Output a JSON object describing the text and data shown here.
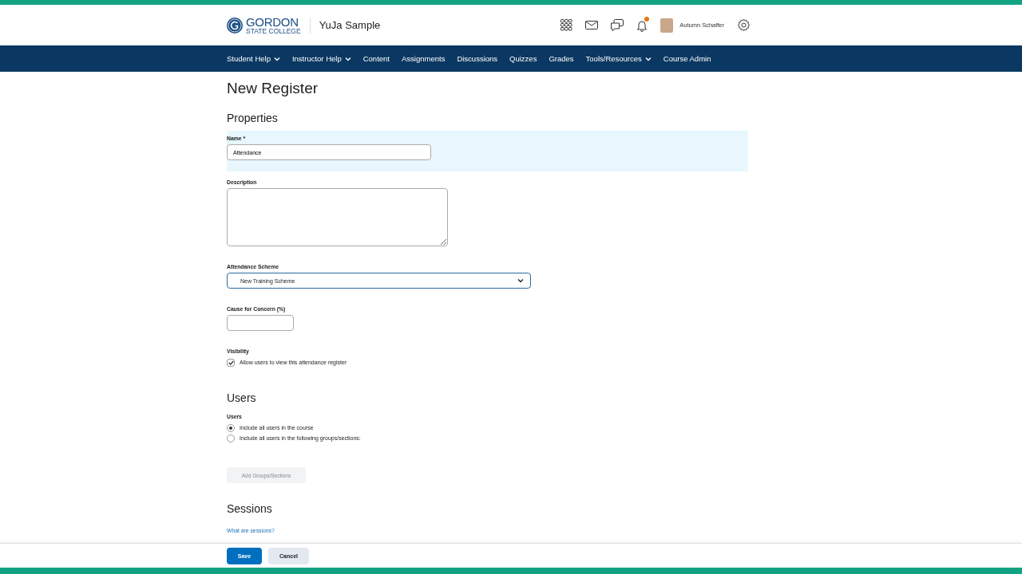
{
  "header": {
    "logo_main": "GORDON",
    "logo_sub": "STATE COLLEGE",
    "course": "YuJa Sample",
    "user": "Autumn Schaffer",
    "notification": true
  },
  "nav": [
    {
      "label": "Student Help",
      "menu": true
    },
    {
      "label": "Instructor Help",
      "menu": true
    },
    {
      "label": "Content",
      "menu": false
    },
    {
      "label": "Assignments",
      "menu": false
    },
    {
      "label": "Discussions",
      "menu": false
    },
    {
      "label": "Quizzes",
      "menu": false
    },
    {
      "label": "Grades",
      "menu": false
    },
    {
      "label": "Tools/Resources",
      "menu": true
    },
    {
      "label": "Course Admin",
      "menu": false
    }
  ],
  "page_title": "New Register",
  "properties": {
    "heading": "Properties",
    "name_label": "Name",
    "required_mark": "*",
    "name_value": "Attendance",
    "description_label": "Description",
    "scheme_label": "Attendance Scheme",
    "scheme_value": "New Training Scheme",
    "concern_label": "Cause for Concern (%)",
    "visibility_label": "Visibility",
    "visibility_option": {
      "label": "Allow users to view this attendance register",
      "checked": true
    }
  },
  "users": {
    "heading": "Users",
    "label": "Users",
    "options": [
      {
        "label": "Include all users in the course",
        "selected": true
      },
      {
        "label": "Include all users in the following groups/sections:",
        "selected": false
      }
    ],
    "add_button": {
      "label": "Add Groups/Sections",
      "disabled": true
    }
  },
  "sessions": {
    "heading": "Sessions",
    "link": "What are sessions?"
  },
  "footer": {
    "buttons": [
      {
        "label": "Save",
        "kind": "primary"
      },
      {
        "label": "Cancel",
        "kind": "secondary"
      }
    ]
  }
}
